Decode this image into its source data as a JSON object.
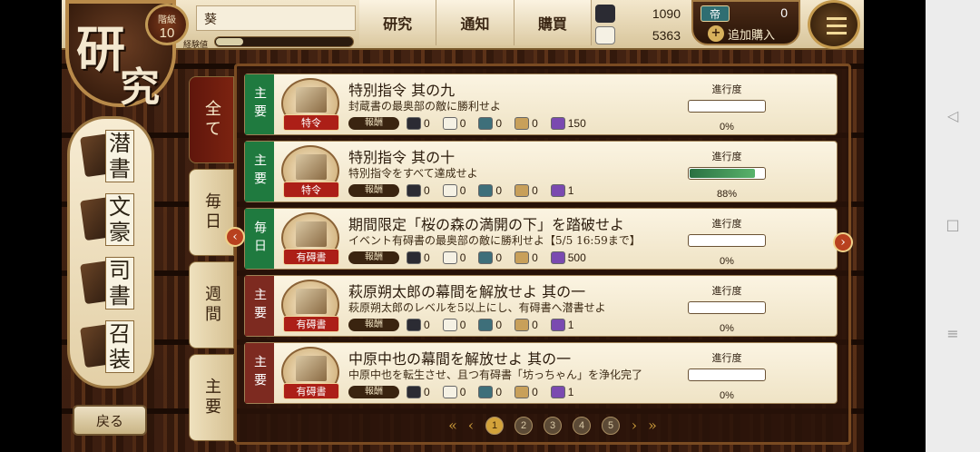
{
  "header": {
    "title_char_1": "研",
    "title_char_2": "究",
    "level_label": "階級",
    "level_value": "10",
    "player_name": "葵",
    "exp_label": "経験値",
    "exp_progress": 0.2,
    "tabs": [
      "研究",
      "通知",
      "購買"
    ],
    "resources": [
      {
        "icon": "ink-icon",
        "value": "1090"
      },
      {
        "icon": "rice-ball-icon",
        "value": "5363"
      }
    ],
    "ticket_icon_label": "帝",
    "ticket_count": "0",
    "buy_label": "追加購入",
    "buy_plus": "+",
    "menu_icon": "hamburger-icon"
  },
  "sidebar": {
    "items": [
      {
        "label": "潜書"
      },
      {
        "label": "文豪"
      },
      {
        "label": "司書"
      },
      {
        "label": "召装"
      }
    ],
    "back_label": "戻る"
  },
  "categories": [
    "全て",
    "毎日",
    "週間",
    "主要"
  ],
  "mission_labels": {
    "reward": "報酬",
    "progress": "進行度"
  },
  "missions": [
    {
      "type": "主要",
      "tag": "特令",
      "title": "特別指令 其の九",
      "desc": "封蔵書の最奥部の敵に勝利せよ",
      "rewards": [
        "0",
        "0",
        "0",
        "0",
        "150"
      ],
      "progress": "0%",
      "progress_value": 0
    },
    {
      "type": "主要",
      "tag": "特令",
      "title": "特別指令 其の十",
      "desc": "特別指令をすべて達成せよ",
      "rewards": [
        "0",
        "0",
        "0",
        "0",
        "1"
      ],
      "progress": "88%",
      "progress_value": 0.88
    },
    {
      "type": "毎日",
      "tag": "有碍書",
      "title": "期間限定「桜の森の満開の下」を踏破せよ",
      "desc": "イベント有碍書の最奥部の敵に勝利せよ【5/5 16:59まで】",
      "rewards": [
        "0",
        "0",
        "0",
        "0",
        "500"
      ],
      "progress": "0%",
      "progress_value": 0
    },
    {
      "type": "主要",
      "tag": "有碍書",
      "title": "萩原朔太郎の幕間を解放せよ 其の一",
      "desc": "萩原朔太郎のレベルを5以上にし、有碍書へ潜書せよ",
      "rewards": [
        "0",
        "0",
        "0",
        "0",
        "1"
      ],
      "progress": "0%",
      "progress_value": 0
    },
    {
      "type": "主要",
      "tag": "有碍書",
      "title": "中原中也の幕間を解放せよ 其の一",
      "desc": "中原中也を転生させ、且つ有碍書「坊っちゃん」を浄化完了",
      "rewards": [
        "0",
        "0",
        "0",
        "0",
        "1"
      ],
      "progress": "0%",
      "progress_value": 0
    }
  ],
  "pager": {
    "pages": [
      "1",
      "2",
      "3",
      "4",
      "5"
    ],
    "current": "1"
  },
  "colors": {
    "brand_red": "#ac1f17",
    "green_type": "#1f7a3f",
    "red_type": "#7d2a20",
    "progress_green": "#59b36b"
  }
}
